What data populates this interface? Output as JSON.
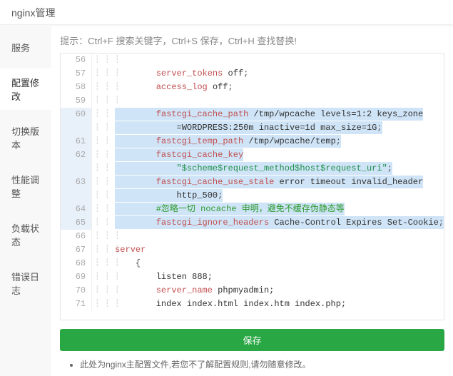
{
  "title": "nginx管理",
  "sidebar": {
    "items": [
      {
        "label": "服务"
      },
      {
        "label": "配置修改"
      },
      {
        "label": "切换版本"
      },
      {
        "label": "性能调整"
      },
      {
        "label": "负载状态"
      },
      {
        "label": "错误日志"
      }
    ],
    "activeIndex": 1
  },
  "hint": "提示：Ctrl+F 搜索关键字，Ctrl+S 保存，Ctrl+H 查找替换!",
  "saveLabel": "保存",
  "footnote": "此处为nginx主配置文件,若您不了解配置规则,请勿随意修改。",
  "editor": {
    "selectionStartLine": 60,
    "selectionEndLine": 65,
    "lines": [
      {
        "no": 56,
        "tokens": []
      },
      {
        "no": 57,
        "tokens": [
          {
            "t": "key",
            "v": "        server_tokens "
          },
          {
            "t": "name",
            "v": "off"
          },
          {
            "t": "punct",
            "v": ";"
          }
        ]
      },
      {
        "no": 58,
        "tokens": [
          {
            "t": "key",
            "v": "        access_log "
          },
          {
            "t": "name",
            "v": "off"
          },
          {
            "t": "punct",
            "v": ";"
          }
        ]
      },
      {
        "no": 59,
        "tokens": []
      },
      {
        "no": 60,
        "selected": true,
        "tokens": [
          {
            "t": "key",
            "v": "        fastcgi_cache_path "
          },
          {
            "t": "name",
            "v": "/tmp/wpcache levels=1:2 keys_zone"
          }
        ]
      },
      {
        "no": null,
        "selected": true,
        "tokens": [
          {
            "t": "name",
            "v": "            =WORDPRESS:250m inactive=1d max_size=1G"
          },
          {
            "t": "punct",
            "v": ";"
          }
        ]
      },
      {
        "no": 61,
        "selected": true,
        "tokens": [
          {
            "t": "key",
            "v": "        fastcgi_temp_path "
          },
          {
            "t": "name",
            "v": "/tmp/wpcache/temp"
          },
          {
            "t": "punct",
            "v": ";"
          }
        ]
      },
      {
        "no": 62,
        "selected": true,
        "tokens": [
          {
            "t": "key",
            "v": "        fastcgi_cache_key"
          }
        ]
      },
      {
        "no": null,
        "selected": true,
        "tokens": [
          {
            "t": "str",
            "v": "            \"$scheme$request_method$host$request_uri\""
          },
          {
            "t": "punct",
            "v": ";"
          }
        ]
      },
      {
        "no": 63,
        "selected": true,
        "tokens": [
          {
            "t": "key",
            "v": "        fastcgi_cache_use_stale "
          },
          {
            "t": "name",
            "v": "error timeout invalid_header"
          }
        ]
      },
      {
        "no": null,
        "selected": true,
        "tokens": [
          {
            "t": "name",
            "v": "            http_500"
          },
          {
            "t": "punct",
            "v": ";"
          }
        ]
      },
      {
        "no": 64,
        "selected": true,
        "tokens": [
          {
            "t": "cmt",
            "v": "        #忽略一切 nocache 申明，避免不缓存伪静态等"
          }
        ]
      },
      {
        "no": 65,
        "selected": true,
        "tokens": [
          {
            "t": "key",
            "v": "        fastcgi_ignore_headers "
          },
          {
            "t": "name",
            "v": "Cache-Control Expires Set-Cookie"
          },
          {
            "t": "punct",
            "v": ";"
          }
        ]
      },
      {
        "no": 66,
        "tokens": []
      },
      {
        "no": 67,
        "tokens": [
          {
            "t": "key",
            "v": "server"
          }
        ]
      },
      {
        "no": 68,
        "tokens": [
          {
            "t": "punct",
            "v": "    {"
          }
        ]
      },
      {
        "no": 69,
        "tokens": [
          {
            "t": "name",
            "v": "        listen 888;"
          }
        ]
      },
      {
        "no": 70,
        "tokens": [
          {
            "t": "key",
            "v": "        server_name "
          },
          {
            "t": "name",
            "v": "phpmyadmin;"
          }
        ]
      },
      {
        "no": 71,
        "tokens": [
          {
            "t": "name",
            "v": "        index index.html index.htm index.php;"
          }
        ]
      }
    ]
  }
}
